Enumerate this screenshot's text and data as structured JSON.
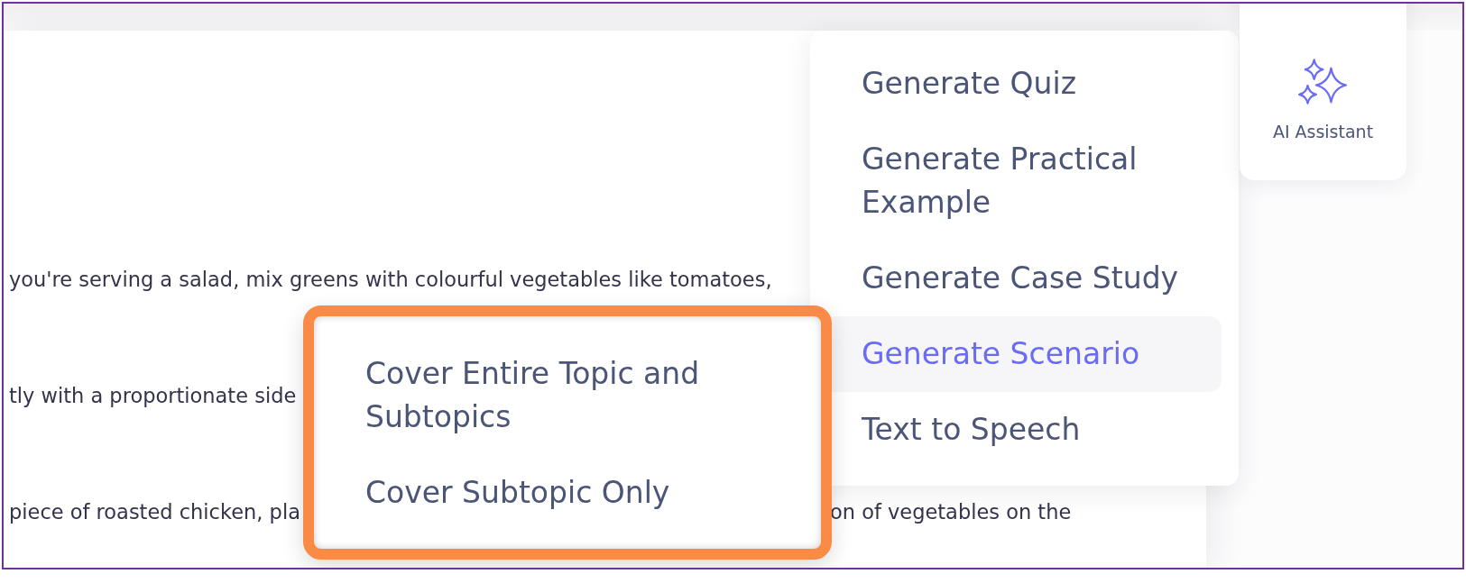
{
  "article": {
    "lines": [
      {
        "parts": [
          "you're serving a salad, mix greens with colourful vegetables like tomatoes,"
        ]
      },
      {
        "parts": [
          "tly with a proportionate side"
        ]
      },
      {
        "parts": [
          "piece of roasted chicken, pla",
          "on of vegetables on the"
        ]
      }
    ]
  },
  "menu": {
    "items": [
      {
        "label": "Generate Quiz",
        "selected": false
      },
      {
        "label": "Generate Practical Example",
        "selected": false
      },
      {
        "label": "Generate Case Study",
        "selected": false
      },
      {
        "label": "Generate Scenario",
        "selected": true
      },
      {
        "label": "Text to Speech",
        "selected": false
      }
    ]
  },
  "submenu": {
    "items": [
      {
        "label": "Cover Entire Topic and Subtopics",
        "selected": false
      },
      {
        "label": "Cover Subtopic Only",
        "selected": false
      }
    ]
  },
  "ai_assistant": {
    "label": "AI Assistant"
  }
}
